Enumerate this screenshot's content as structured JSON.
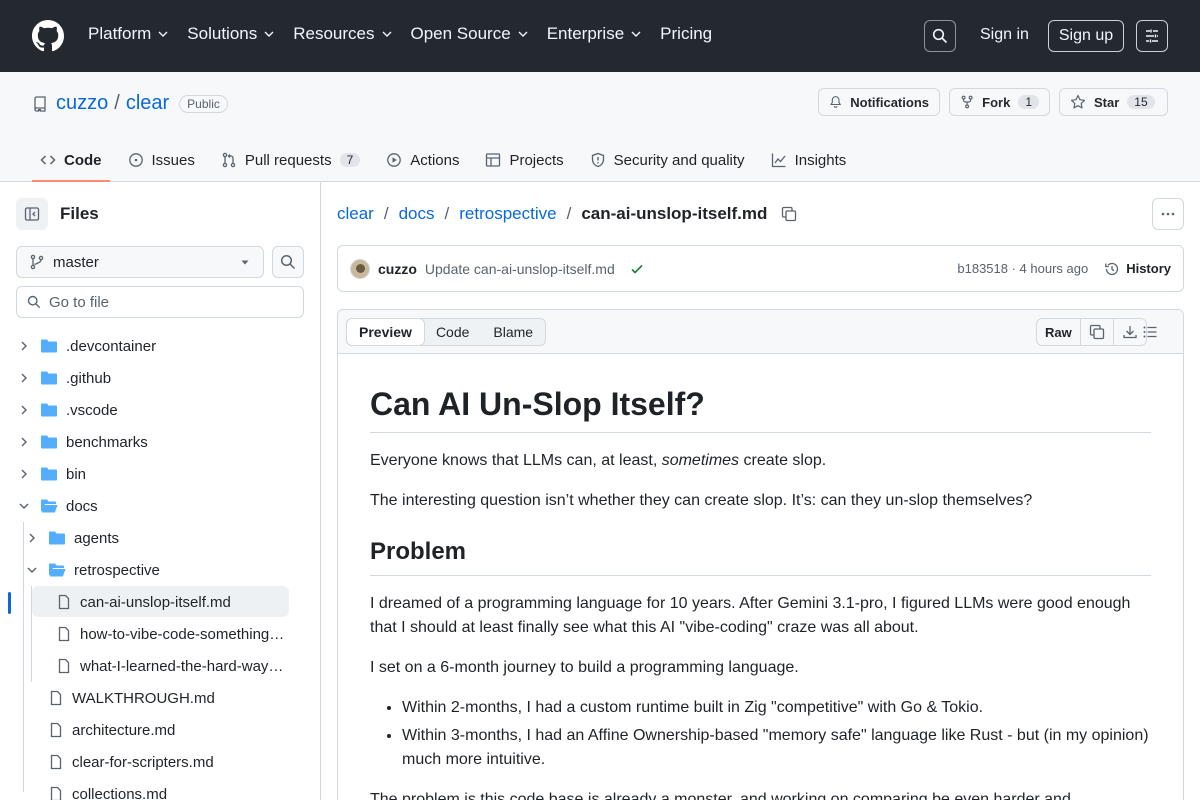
{
  "topnav": {
    "items": [
      "Platform",
      "Solutions",
      "Resources",
      "Open Source",
      "Enterprise",
      "Pricing"
    ],
    "sign_in": "Sign in",
    "sign_up": "Sign up"
  },
  "repo": {
    "owner": "cuzzo",
    "name": "clear",
    "visibility": "Public",
    "notifications_label": "Notifications",
    "fork_label": "Fork",
    "fork_count": "1",
    "star_label": "Star",
    "star_count": "15"
  },
  "tabs": [
    {
      "label": "Code",
      "icon": "code-icon"
    },
    {
      "label": "Issues",
      "icon": "issue-icon"
    },
    {
      "label": "Pull requests",
      "icon": "pull-request-icon",
      "count": "7"
    },
    {
      "label": "Actions",
      "icon": "play-icon"
    },
    {
      "label": "Projects",
      "icon": "table-icon"
    },
    {
      "label": "Security and quality",
      "icon": "shield-icon"
    },
    {
      "label": "Insights",
      "icon": "graph-icon"
    }
  ],
  "sidebar": {
    "title": "Files",
    "branch": "master",
    "goto_placeholder": "Go to file",
    "tree": [
      {
        "label": ".devcontainer",
        "type": "folder"
      },
      {
        "label": ".github",
        "type": "folder"
      },
      {
        "label": ".vscode",
        "type": "folder"
      },
      {
        "label": "benchmarks",
        "type": "folder"
      },
      {
        "label": "bin",
        "type": "folder"
      },
      {
        "label": "docs",
        "type": "folder-open"
      },
      {
        "label": "agents",
        "type": "folder"
      },
      {
        "label": "retrospective",
        "type": "folder-open"
      },
      {
        "label": "can-ai-unslop-itself.md",
        "type": "file"
      },
      {
        "label": "how-to-vibe-code-something…",
        "type": "file"
      },
      {
        "label": "what-I-learned-the-hard-way…",
        "type": "file"
      },
      {
        "label": "WALKTHROUGH.md",
        "type": "file"
      },
      {
        "label": "architecture.md",
        "type": "file"
      },
      {
        "label": "clear-for-scripters.md",
        "type": "file"
      },
      {
        "label": "collections.md",
        "type": "file"
      }
    ]
  },
  "breadcrumb": {
    "parts": [
      "clear",
      "docs",
      "retrospective"
    ],
    "current": "can-ai-unslop-itself.md"
  },
  "commit": {
    "author": "cuzzo",
    "message": "Update can-ai-unslop-itself.md",
    "hash_time": "b183518 · 4 hours ago",
    "history_label": "History"
  },
  "file_toolbar": {
    "tabs": [
      "Preview",
      "Code",
      "Blame"
    ],
    "raw_label": "Raw"
  },
  "markdown": {
    "h1": "Can AI Un-Slop Itself?",
    "p1_a": "Everyone knows that LLMs can, at least, ",
    "p1_em": "sometimes",
    "p1_b": " create slop.",
    "p2": "The interesting question isn’t whether they can create slop. It’s: can they un-slop themselves?",
    "h2": "Problem",
    "p3": "I dreamed of a programming language for 10 years. After Gemini 3.1-pro, I figured LLMs were good enough that I should at least finally see what this AI \"vibe-coding\" craze was all about.",
    "p4": "I set on a 6-month journey to build a programming language.",
    "li1": "Within 2-months, I had a custom runtime built in Zig \"competitive\" with Go & Tokio.",
    "li2": "Within 3-months, I had an Affine Ownership-based \"memory safe\" language like Rust - but (in my opinion) much more intuitive.",
    "p5": "The problem is this code base is already a monster. and working on comparing be even harder and..."
  }
}
